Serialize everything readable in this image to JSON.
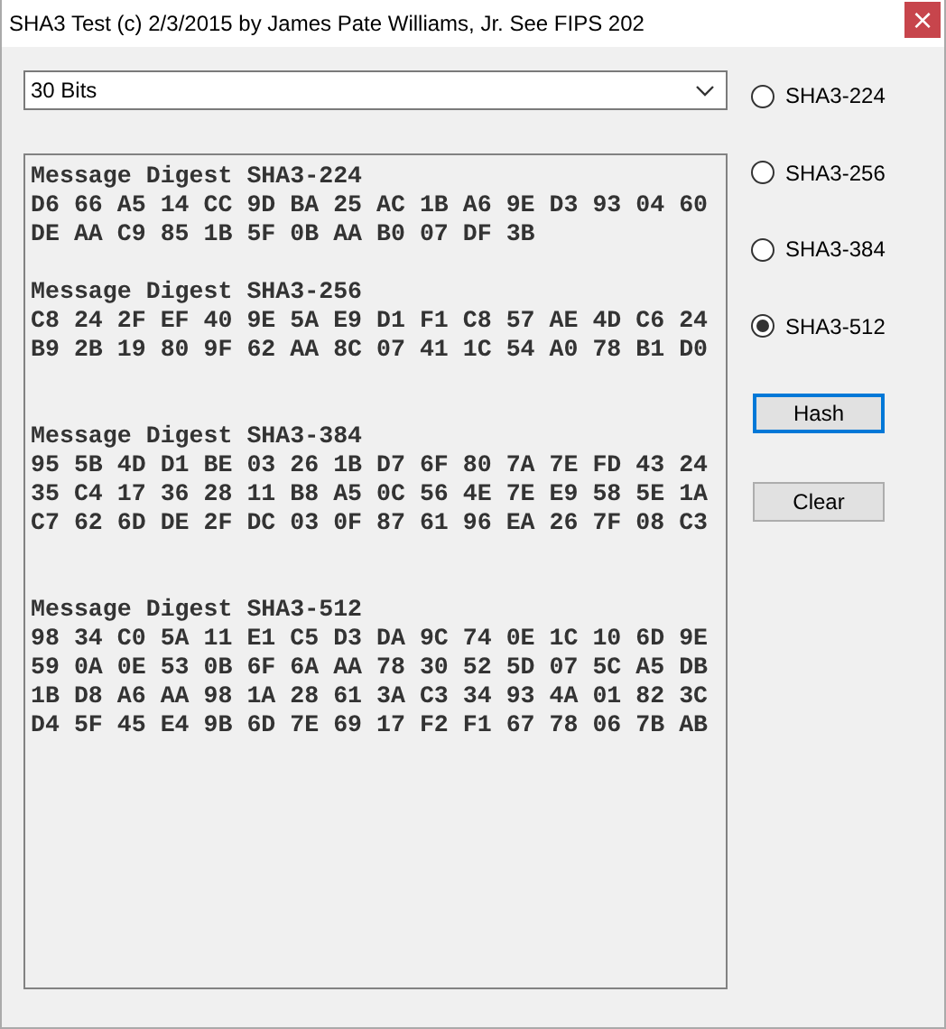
{
  "window": {
    "title": "SHA3 Test (c) 2/3/2015 by James Pate Williams, Jr. See FIPS 202",
    "close": "×"
  },
  "bits_dropdown": {
    "value": "30 Bits"
  },
  "output": {
    "value": "Message Digest SHA3-224\nD6 66 A5 14 CC 9D BA 25 AC 1B A6 9E D3 93 04 60\nDE AA C9 85 1B 5F 0B AA B0 07 DF 3B\n\nMessage Digest SHA3-256\nC8 24 2F EF 40 9E 5A E9 D1 F1 C8 57 AE 4D C6 24\nB9 2B 19 80 9F 62 AA 8C 07 41 1C 54 A0 78 B1 D0\n\n\nMessage Digest SHA3-384\n95 5B 4D D1 BE 03 26 1B D7 6F 80 7A 7E FD 43 24\n35 C4 17 36 28 11 B8 A5 0C 56 4E 7E E9 58 5E 1A\nC7 62 6D DE 2F DC 03 0F 87 61 96 EA 26 7F 08 C3\n\n\nMessage Digest SHA3-512\n98 34 C0 5A 11 E1 C5 D3 DA 9C 74 0E 1C 10 6D 9E\n59 0A 0E 53 0B 6F 6A AA 78 30 52 5D 07 5C A5 DB\n1B D8 A6 AA 98 1A 28 61 3A C3 34 93 4A 01 82 3C\nD4 5F 45 E4 9B 6D 7E 69 17 F2 F1 67 78 06 7B AB"
  },
  "algorithms": [
    {
      "label": "SHA3-224",
      "selected": false
    },
    {
      "label": "SHA3-256",
      "selected": false
    },
    {
      "label": "SHA3-384",
      "selected": false
    },
    {
      "label": "SHA3-512",
      "selected": true
    }
  ],
  "buttons": [
    {
      "label": "Hash",
      "focused": true
    },
    {
      "label": "Clear",
      "focused": false
    }
  ]
}
